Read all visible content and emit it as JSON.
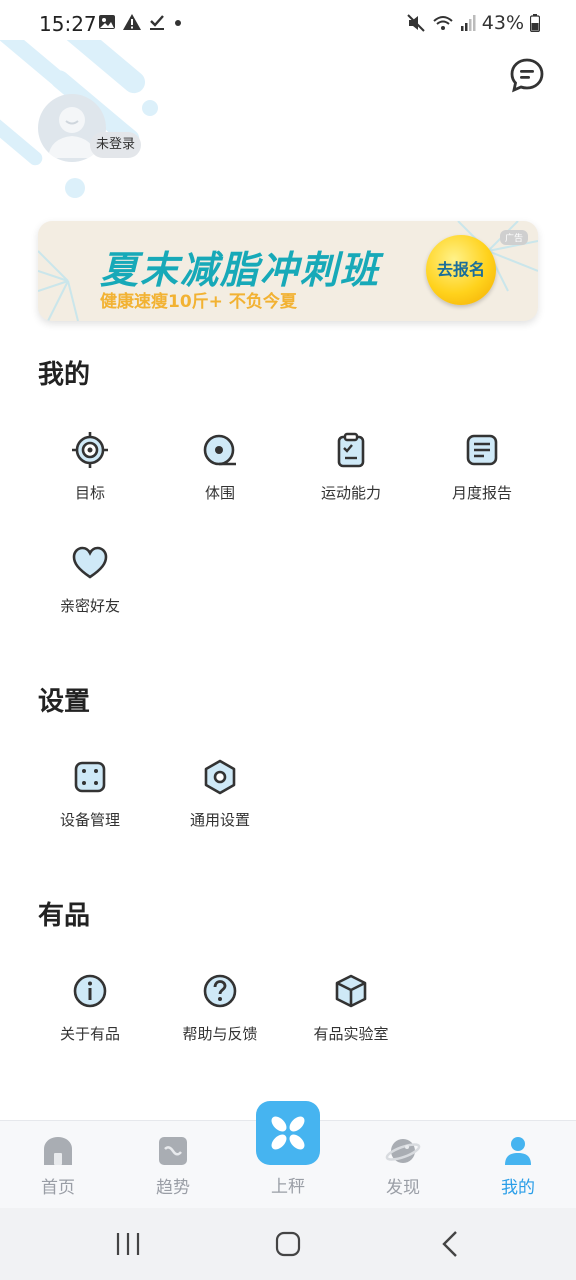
{
  "status_bar": {
    "time": "15:27",
    "battery": "43%"
  },
  "profile": {
    "login_status": "未登录"
  },
  "banner": {
    "title": "夏末减脂冲刺班",
    "subtitle": "健康速瘦10斤+ 不负今夏",
    "cta": "去报名",
    "ad_tag": "广告"
  },
  "sections": {
    "mine": {
      "title": "我的",
      "items": [
        {
          "label": "目标",
          "icon": "target-icon"
        },
        {
          "label": "体围",
          "icon": "tape-measure-icon"
        },
        {
          "label": "运动能力",
          "icon": "clipboard-check-icon"
        },
        {
          "label": "月度报告",
          "icon": "report-icon"
        },
        {
          "label": "亲密好友",
          "icon": "heart-icon"
        }
      ]
    },
    "settings": {
      "title": "设置",
      "items": [
        {
          "label": "设备管理",
          "icon": "device-icon"
        },
        {
          "label": "通用设置",
          "icon": "settings-hex-icon"
        }
      ]
    },
    "youpin": {
      "title": "有品",
      "items": [
        {
          "label": "关于有品",
          "icon": "info-icon"
        },
        {
          "label": "帮助与反馈",
          "icon": "help-icon"
        },
        {
          "label": "有品实验室",
          "icon": "cube-icon"
        }
      ]
    }
  },
  "bottom_nav": {
    "items": [
      {
        "label": "首页",
        "icon": "home-icon"
      },
      {
        "label": "趋势",
        "icon": "trend-icon"
      },
      {
        "label": "上秤",
        "icon": "scale-icon"
      },
      {
        "label": "发现",
        "icon": "planet-icon"
      },
      {
        "label": "我的",
        "icon": "person-icon"
      }
    ],
    "active": "我的"
  },
  "colors": {
    "accent": "#46b4f0",
    "active_nav": "#2a9ee8",
    "icon_fill": "#cfe9f7",
    "icon_stroke": "#333333",
    "banner_title": "#17a9b8",
    "banner_subtitle": "#f2b233"
  }
}
